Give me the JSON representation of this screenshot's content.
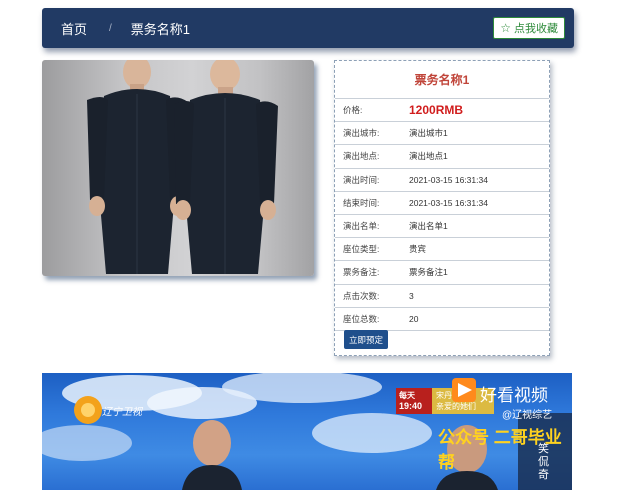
{
  "breadcrumb": {
    "home": "首页",
    "separator": "/",
    "current": "票务名称1"
  },
  "favorite_button": {
    "icon": "star-icon",
    "label": "点我收藏",
    "color": "#2d8a3a"
  },
  "ticket": {
    "title": "票务名称1",
    "rows": [
      {
        "label": "价格:",
        "value": "1200RMB"
      },
      {
        "label": "演出城市:",
        "value": "演出城市1"
      },
      {
        "label": "演出地点:",
        "value": "演出地点1"
      },
      {
        "label": "演出时间:",
        "value": "2021-03-15 16:31:34"
      },
      {
        "label": "结束时间:",
        "value": "2021-03-15 16:31:34"
      },
      {
        "label": "演出名单:",
        "value": "演出名单1"
      },
      {
        "label": "座位类型:",
        "value": "贵宾"
      },
      {
        "label": "票务备注:",
        "value": "票务备注1"
      },
      {
        "label": "点击次数:",
        "value": "3"
      },
      {
        "label": "座位总数:",
        "value": "20"
      }
    ],
    "book_label": "立即预定"
  },
  "video_overlay": {
    "channel_logo": "辽宁卫视",
    "time_box": {
      "line1": "每天",
      "line2": "19:40"
    },
    "program": {
      "line1": "宋丹",
      "line2": "亲爱的她们"
    },
    "app_name": "好看视频",
    "account": "@辽视综艺",
    "watermark": "公众号 二哥毕业帮",
    "side_text": "笑侃奇"
  },
  "colors": {
    "nav_bg": "#213a64",
    "title_red": "#c0453a",
    "price_red": "#d11d1d",
    "button_blue": "#1f4f8c"
  }
}
